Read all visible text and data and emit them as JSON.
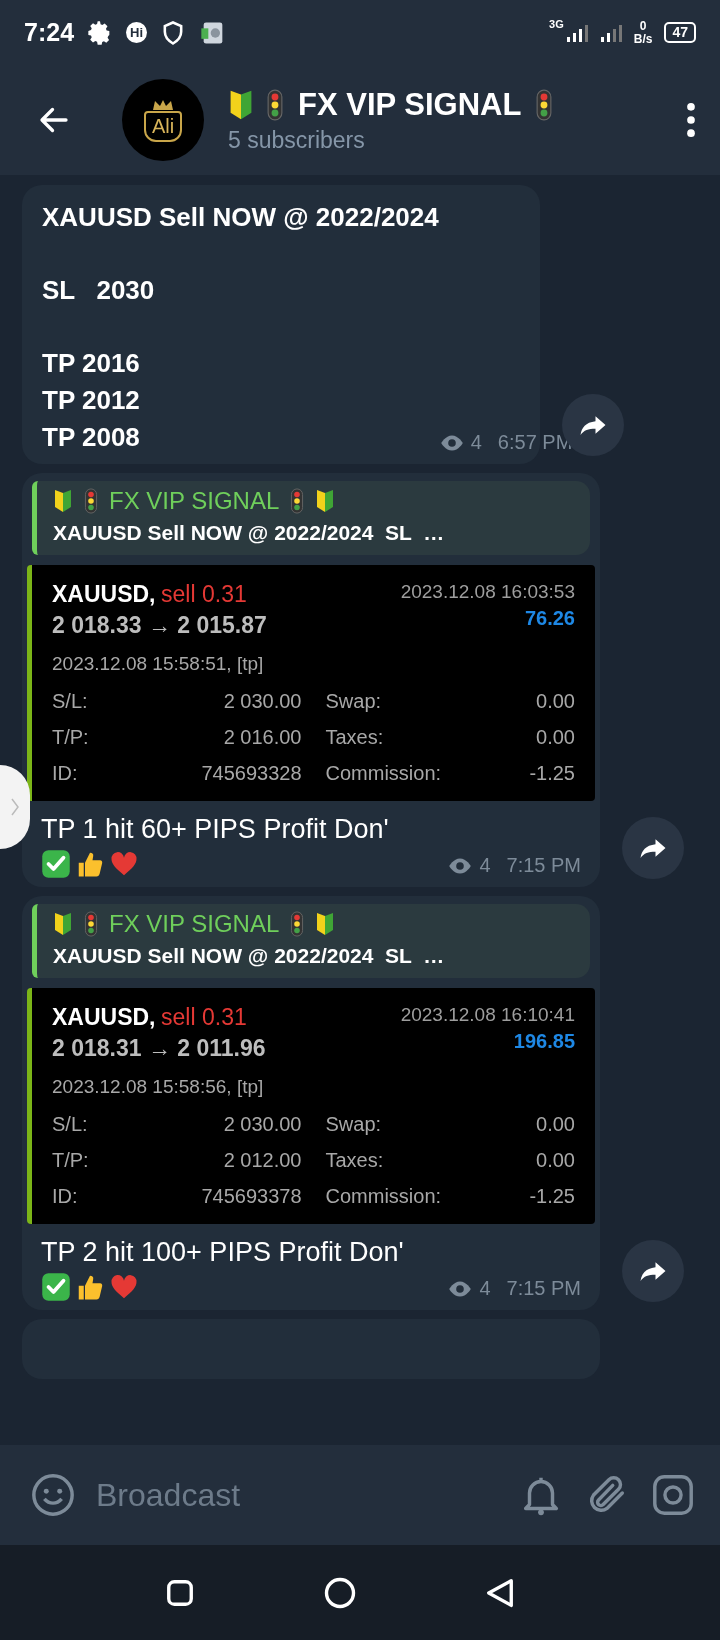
{
  "status_bar": {
    "time": "7:24",
    "app_badge": "Hi",
    "network": "3G",
    "speed_value": "0",
    "speed_unit": "B/s",
    "battery": "47"
  },
  "header": {
    "avatar_text": "Ali",
    "title": "FX VIP SIGNAL",
    "subtitle": "5 subscribers"
  },
  "messages": [
    {
      "kind": "text",
      "paragraphs": [
        [
          "XAUUSD Sell NOW @ 2022/2024"
        ],
        [
          "SL   2030"
        ],
        [
          "TP 2016",
          "TP 2012",
          "TP 2008"
        ]
      ],
      "views": "4",
      "time": "6:57 PM"
    },
    {
      "kind": "trade",
      "reply": {
        "author": "FX VIP SIGNAL",
        "text": "XAUUSD Sell NOW @ 2022/2024  SL  …"
      },
      "trade": {
        "symbol": "XAUUSD,",
        "side": "sell 0.31",
        "close_time": "2023.12.08 16:03:53",
        "prices": "2 018.33 → 2 015.87",
        "profit": "76.26",
        "open_time": "2023.12.08 15:58:51, [tp]",
        "rows": [
          {
            "label": "S/L:",
            "value": "2 030.00",
            "label2": "Swap:",
            "value2": "0.00"
          },
          {
            "label": "T/P:",
            "value": "2 016.00",
            "label2": "Taxes:",
            "value2": "0.00"
          },
          {
            "label": "ID:",
            "value": "745693328",
            "label2": "Commission:",
            "value2": "-1.25"
          }
        ]
      },
      "caption": "TP 1 hit 60+ PIPS Profit Don'",
      "views": "4",
      "time": "7:15 PM"
    },
    {
      "kind": "trade",
      "reply": {
        "author": "FX VIP SIGNAL",
        "text": "XAUUSD Sell NOW @ 2022/2024  SL  …"
      },
      "trade": {
        "symbol": "XAUUSD,",
        "side": "sell 0.31",
        "close_time": "2023.12.08 16:10:41",
        "prices": "2 018.31 → 2 011.96",
        "profit": "196.85",
        "open_time": "2023.12.08 15:58:56, [tp]",
        "rows": [
          {
            "label": "S/L:",
            "value": "2 030.00",
            "label2": "Swap:",
            "value2": "0.00"
          },
          {
            "label": "T/P:",
            "value": "2 012.00",
            "label2": "Taxes:",
            "value2": "0.00"
          },
          {
            "label": "ID:",
            "value": "745693378",
            "label2": "Commission:",
            "value2": "-1.25"
          }
        ]
      },
      "caption": "TP 2 hit 100+ PIPS Profit Don'",
      "views": "4",
      "time": "7:15 PM"
    }
  ],
  "composer": {
    "placeholder": "Broadcast"
  }
}
